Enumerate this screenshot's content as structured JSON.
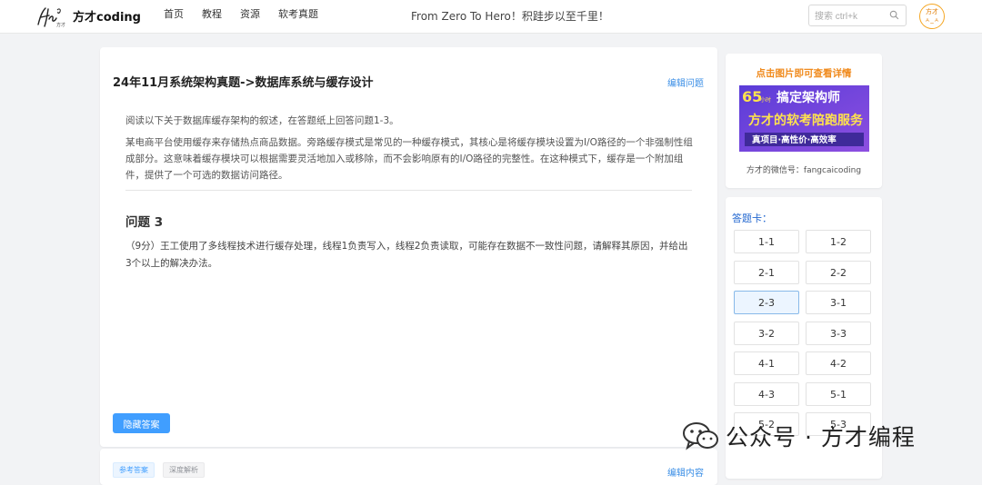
{
  "header": {
    "brand": "方才coding",
    "nav": [
      "首页",
      "教程",
      "资源",
      "软考真题"
    ],
    "slogan": "From Zero To Hero！积跬步以至千里！",
    "search_placeholder": "搜索 ctrl+k",
    "avatar_line1": "方才",
    "avatar_line2": "ㅅ_ㅅ"
  },
  "question": {
    "title": "24年11月系统架构真题->数据库系统与缓存设计",
    "edit_link": "编辑问题",
    "intro": "阅读以下关于数据库缓存架构的叙述，在答题纸上回答问题1-3。",
    "description": "某电商平台使用缓存来存储热点商品数据。旁路缓存模式是常见的一种缓存模式，其核心是将缓存模块设置为I/O路径的一个非强制性组成部分。这意味着缓存模块可以根据需要灵活地加入或移除，而不会影响原有的I/O路径的完整性。在这种模式下，缓存是一个附加组件，提供了一个可选的数据访问路径。",
    "problem_title": "问题 3",
    "problem_text": "（9分）王工使用了多线程技术进行缓存处理，线程1负责写入，线程2负责读取，可能存在数据不一致性问题，请解释其原因，并给出3个以上的解决办法。",
    "hide_button": "隐藏答案"
  },
  "answer_section": {
    "tabs": [
      "参考答案",
      "深度解析"
    ],
    "edit_link": "编辑内容"
  },
  "promo": {
    "header": "点击图片即可查看详情",
    "banner_line1_num": "65",
    "banner_line1_small": "小时",
    "banner_line1_text": "搞定架构师",
    "banner_line2": "方才的软考陪跑服务",
    "banner_line3": "真项目·高性价·高效率",
    "wechat": "方才的微信号：fangcaicoding"
  },
  "answer_card": {
    "header": "答题卡：",
    "items": [
      "1-1",
      "1-2",
      "2-1",
      "2-2",
      "2-3",
      "3-1",
      "3-2",
      "3-3",
      "4-1",
      "4-2",
      "4-3",
      "5-1",
      "5-2",
      "5-3"
    ],
    "active": "2-3"
  },
  "watermark": {
    "text": "公众号 · 方才编程"
  },
  "colors": {
    "accent": "#409eff",
    "link": "#3a8ee6",
    "promo_orange": "#f08a1c",
    "banner_purple": "#6b3fd6"
  }
}
